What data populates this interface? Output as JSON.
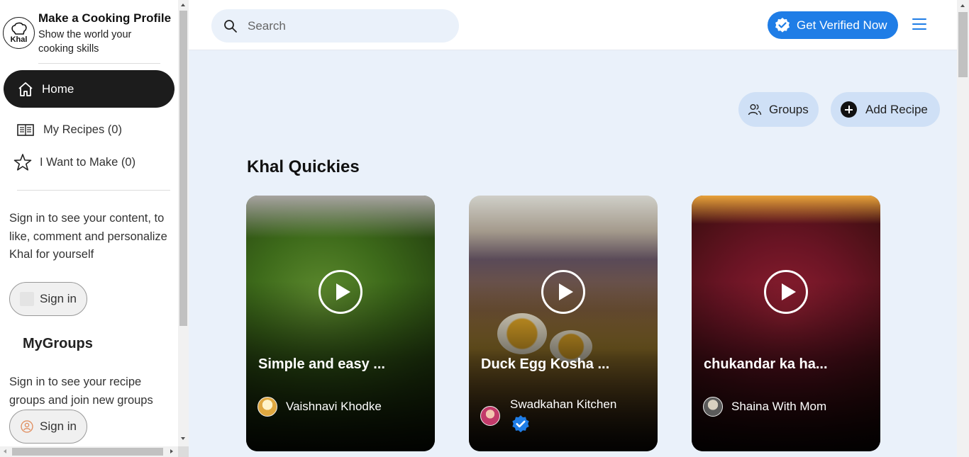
{
  "brand": {
    "logo_text": "Khal",
    "title": "Make a Cooking Profile",
    "subtitle": "Show the world your cooking skills"
  },
  "nav": {
    "home": "Home",
    "my_recipes": "My Recipes (0)",
    "want_to_make": "I Want to Make (0)"
  },
  "signin_prompt": "Sign in to see your content, to like, comment and personalize Khal for yourself",
  "signin_label": "Sign in",
  "mygroups": {
    "title": "MyGroups",
    "prompt": "Sign in to see your recipe groups and join new groups",
    "signin_label": "Sign in"
  },
  "search": {
    "placeholder": "Search"
  },
  "header": {
    "verify_label": "Get Verified Now"
  },
  "actions": {
    "groups": "Groups",
    "add_recipe": "Add Recipe"
  },
  "section_title": "Khal Quickies",
  "cards": [
    {
      "title": "Simple and easy ...",
      "author": "Vaishnavi Khodke",
      "verified": false
    },
    {
      "title": "Duck Egg Kosha ...",
      "author": "Swadkahan Kitchen",
      "verified": true
    },
    {
      "title": "chukandar ka ha...",
      "author": "Shaina With Mom",
      "verified": false
    }
  ],
  "colors": {
    "accent": "#1f7de6",
    "main_bg": "#eaf1fa",
    "pill_bg": "#cfe0f6",
    "nav_active": "#1c1c1c"
  }
}
